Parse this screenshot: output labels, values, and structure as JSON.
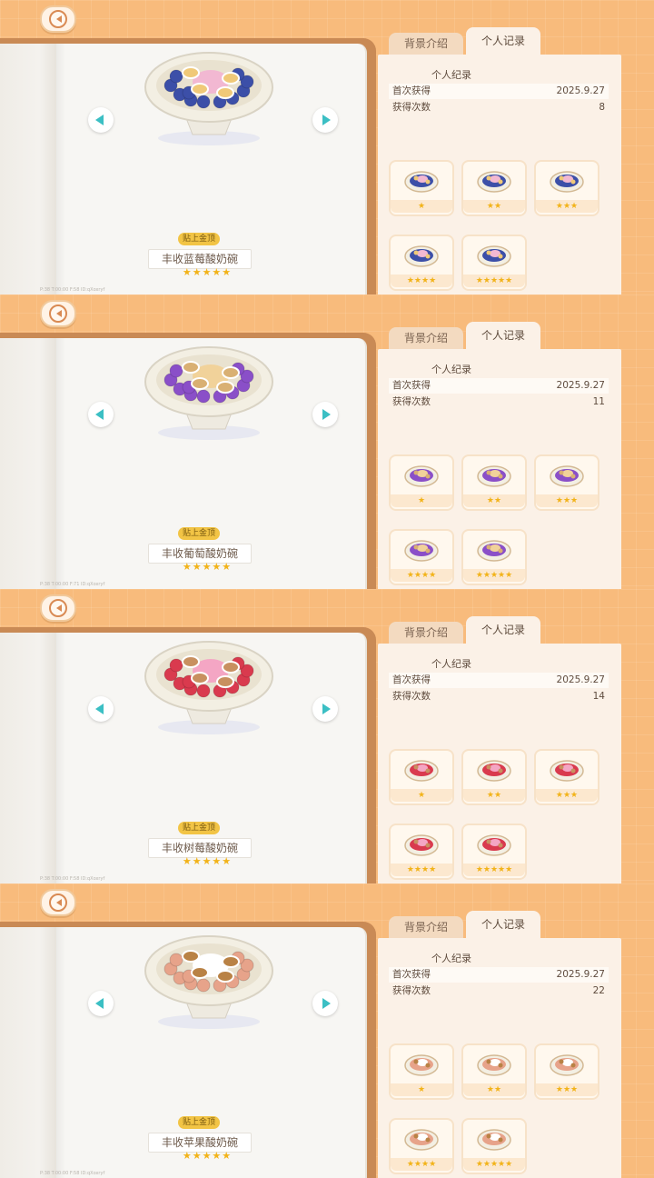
{
  "panels": [
    {
      "dish_name": "丰收蓝莓酸奶碗",
      "badge": "贴上金顶",
      "main_stars": "★★★★★",
      "debug_text": "P:38  T:00:00  F:58  ID:qXoxryf",
      "tabs": {
        "background": "背景介绍",
        "record": "个人记录"
      },
      "record_title": "个人纪录",
      "first_obtained_label": "首次获得",
      "first_obtained_value": "2025.9.27",
      "times_obtained_label": "获得次数",
      "times_obtained_value": "8",
      "variant_stars": [
        "★",
        "★★",
        "★★★",
        "★★★★",
        "★★★★★"
      ],
      "colors": {
        "fruit": "#3c4fa8",
        "center": "#f2b8d2",
        "topping": "#f0c978"
      }
    },
    {
      "dish_name": "丰收葡萄酸奶碗",
      "badge": "贴上金顶",
      "main_stars": "★★★★★",
      "debug_text": "P:38  T:00:00  F:71  ID:qXoxryf",
      "tabs": {
        "background": "背景介绍",
        "record": "个人记录"
      },
      "record_title": "个人纪录",
      "first_obtained_label": "首次获得",
      "first_obtained_value": "2025.9.27",
      "times_obtained_label": "获得次数",
      "times_obtained_value": "11",
      "variant_stars": [
        "★",
        "★★",
        "★★★",
        "★★★★",
        "★★★★★"
      ],
      "colors": {
        "fruit": "#8a4fc8",
        "center": "#f1d29a",
        "topping": "#d9b073"
      }
    },
    {
      "dish_name": "丰收树莓酸奶碗",
      "badge": "贴上金顶",
      "main_stars": "★★★★★",
      "debug_text": "P:38  T:00:00  F:58  ID:qXoxryf",
      "tabs": {
        "background": "背景介绍",
        "record": "个人记录"
      },
      "record_title": "个人纪录",
      "first_obtained_label": "首次获得",
      "first_obtained_value": "2025.9.27",
      "times_obtained_label": "获得次数",
      "times_obtained_value": "14",
      "variant_stars": [
        "★",
        "★★",
        "★★★",
        "★★★★",
        "★★★★★"
      ],
      "colors": {
        "fruit": "#d93a4e",
        "center": "#f4a6c4",
        "topping": "#c89060"
      }
    },
    {
      "dish_name": "丰收苹果酸奶碗",
      "badge": "贴上金顶",
      "main_stars": "★★★★★",
      "debug_text": "P:38  T:00:00  F:58  ID:qXoxryf",
      "tabs": {
        "background": "背景介绍",
        "record": "个人记录"
      },
      "record_title": "个人纪录",
      "first_obtained_label": "首次获得",
      "first_obtained_value": "2025.9.27",
      "times_obtained_label": "获得次数",
      "times_obtained_value": "22",
      "variant_stars": [
        "★",
        "★★",
        "★★★",
        "★★★★",
        "★★★★★"
      ],
      "colors": {
        "fruit": "#e7a38a",
        "center": "#ffffff",
        "topping": "#b98245"
      }
    }
  ]
}
